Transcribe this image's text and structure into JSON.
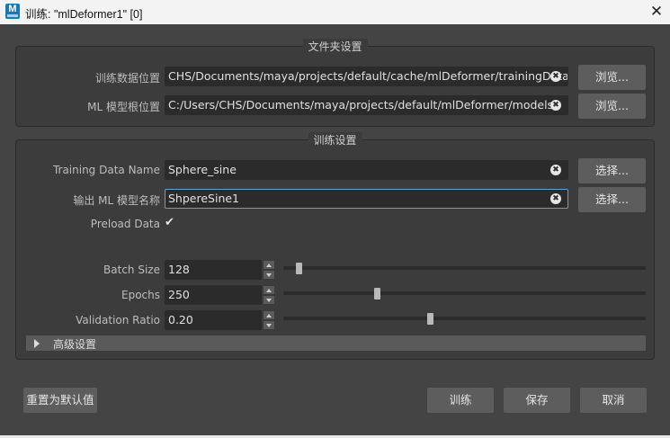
{
  "window": {
    "title": "训练: \"mlDeformer1\" [0]",
    "icon_label": "M",
    "close_label": "✕"
  },
  "folders": {
    "title": "文件夹设置",
    "training_data_location": {
      "label": "训练数据位置",
      "value": "CHS/Documents/maya/projects/default/cache/mlDeformer/trainingData",
      "clear": "✖",
      "browse_label": "浏览..."
    },
    "model_root_location": {
      "label": "ML 模型根位置",
      "value": "C:/Users/CHS/Documents/maya/projects/default/mlDeformer/models",
      "clear": "✖",
      "browse_label": "浏览..."
    }
  },
  "training": {
    "title": "训练设置",
    "training_data_name": {
      "label": "Training Data Name",
      "value": "Sphere_sine",
      "clear": "✖",
      "select_label": "选择..."
    },
    "output_model_name": {
      "label": "输出 ML 模型名称",
      "value": "ShpereSine1",
      "clear": "✖",
      "select_label": "选择..."
    },
    "preload_data": {
      "label": "Preload Data",
      "checked": true,
      "check_glyph": "✔"
    },
    "batch_size": {
      "label": "Batch Size",
      "value": "128",
      "slider_fraction": 0.03
    },
    "epochs": {
      "label": "Epochs",
      "value": "250",
      "slider_fraction": 0.25
    },
    "validation_ratio": {
      "label": "Validation Ratio",
      "value": "0.20",
      "slider_fraction": 0.4
    },
    "advanced": {
      "label": "高级设置",
      "expanded": false
    }
  },
  "buttons": {
    "reset_label": "重置为默认值",
    "train_label": "训练",
    "save_label": "保存",
    "cancel_label": "取消"
  },
  "colors": {
    "background": "#444444",
    "field": "#2b2b2b",
    "button": "#5d5d5d",
    "focus": "#5ea2d4",
    "titlebar": "#f3f3f3"
  }
}
